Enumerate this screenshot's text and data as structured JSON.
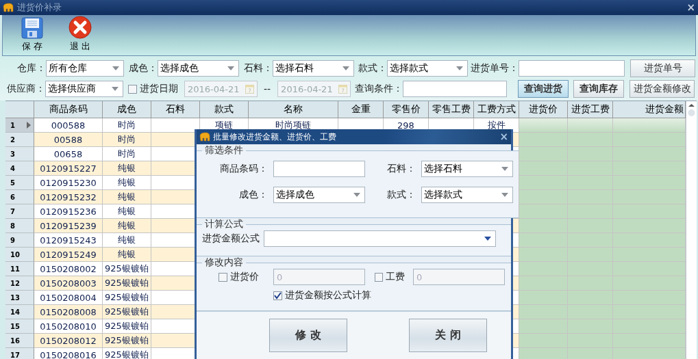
{
  "window": {
    "title": "进货价补录",
    "close": "×"
  },
  "toolbar": [
    {
      "kind": "save",
      "label": "保 存"
    },
    {
      "kind": "exit",
      "label": "退 出"
    }
  ],
  "filters": [
    [
      {
        "kind": "select",
        "label": "仓库：",
        "value": "所有仓库"
      },
      {
        "kind": "select",
        "label": "成色：",
        "value": "选择成色"
      },
      {
        "kind": "select",
        "label": "石料：",
        "value": "选择石料"
      },
      {
        "kind": "select",
        "label": "款式：",
        "value": "选择款式"
      },
      {
        "kind": "input",
        "label": "进货单号："
      },
      {
        "kind": "button",
        "label": "进货单号",
        "bold": false,
        "focused": false
      }
    ],
    [
      {
        "kind": "select",
        "label": "供应商：",
        "value": "选择供应商"
      },
      {
        "kind": "checkbox",
        "label": "进货日期",
        "checked": false
      },
      {
        "kind": "date",
        "value": "2016-04-21",
        "disabled": true
      },
      {
        "kind": "text",
        "label": "--"
      },
      {
        "kind": "date",
        "value": "2016-04-21",
        "disabled": true
      },
      {
        "kind": "input",
        "label": "查询条件："
      },
      {
        "kind": "button",
        "label": "查询进货",
        "bold": true,
        "focused": true
      },
      {
        "kind": "button",
        "label": "查询库存",
        "bold": true,
        "focused": false
      },
      {
        "kind": "button",
        "label": "进货金额修改",
        "bold": false,
        "focused": false
      }
    ]
  ],
  "table": {
    "columns": {
      "barcode": "商品条码",
      "finish": "成色",
      "stone": "石料",
      "style": "款式",
      "name": "名称",
      "gold_weight": "金重",
      "retail_price": "零售价",
      "retail_labor": "零售工费",
      "labor_mode": "工费方式",
      "purchase_price": "进货价",
      "purchase_labor": "进货工费",
      "purchase_amount": "进货金额"
    },
    "rows": [
      {
        "num": "1",
        "current": true,
        "barcode": "000588",
        "finish": "时尚",
        "style": "项链",
        "name": "时尚项链",
        "retail_price": "298",
        "labor_mode": "按件"
      },
      {
        "num": "2",
        "current": false,
        "barcode": "00588",
        "finish": "时尚"
      },
      {
        "num": "3",
        "current": false,
        "barcode": "00658",
        "finish": "时尚"
      },
      {
        "num": "4",
        "current": false,
        "barcode": "0120915227",
        "finish": "纯银"
      },
      {
        "num": "5",
        "current": false,
        "barcode": "0120915230",
        "finish": "纯银"
      },
      {
        "num": "6",
        "current": false,
        "barcode": "0120915232",
        "finish": "纯银"
      },
      {
        "num": "7",
        "current": false,
        "barcode": "0120915236",
        "finish": "纯银"
      },
      {
        "num": "8",
        "current": false,
        "barcode": "0120915239",
        "finish": "纯银"
      },
      {
        "num": "9",
        "current": false,
        "barcode": "0120915243",
        "finish": "纯银"
      },
      {
        "num": "10",
        "current": false,
        "barcode": "0120915249",
        "finish": "纯银"
      },
      {
        "num": "11",
        "current": false,
        "barcode": "0150208002",
        "finish": "925银镀铂"
      },
      {
        "num": "12",
        "current": false,
        "barcode": "0150208003",
        "finish": "925银镀铂"
      },
      {
        "num": "13",
        "current": false,
        "barcode": "0150208004",
        "finish": "925银镀铂"
      },
      {
        "num": "14",
        "current": false,
        "barcode": "0150208008",
        "finish": "925银镀铂"
      },
      {
        "num": "15",
        "current": false,
        "barcode": "0150208010",
        "finish": "925银镀铂"
      },
      {
        "num": "16",
        "current": false,
        "barcode": "0150208012",
        "finish": "925银镀铂"
      },
      {
        "num": "17",
        "current": false,
        "barcode": "0150208016",
        "finish": "925银镀铂"
      }
    ]
  },
  "dialog": {
    "title": "批量修改进货金额、进货价、工费",
    "close": "×",
    "filter": {
      "title": "筛选条件",
      "fields": [
        {
          "kind": "input",
          "label": "商品条码："
        },
        {
          "kind": "select",
          "label": "石料：",
          "value": "选择石料"
        },
        {
          "kind": "select",
          "label": "成色：",
          "value": "选择成色"
        },
        {
          "kind": "select",
          "label": "款式：",
          "value": "选择款式"
        }
      ]
    },
    "formula": {
      "title": "计算公式",
      "label": "进货金额公式"
    },
    "modify": {
      "title": "修改内容",
      "items": [
        {
          "label": "进货价",
          "checked": false,
          "value": "0"
        },
        {
          "label": "工费",
          "checked": false,
          "value": "0"
        }
      ],
      "auto": {
        "label": "进货金额按公式计算",
        "checked": true
      }
    },
    "buttons": [
      "修 改",
      "关 闭"
    ]
  }
}
